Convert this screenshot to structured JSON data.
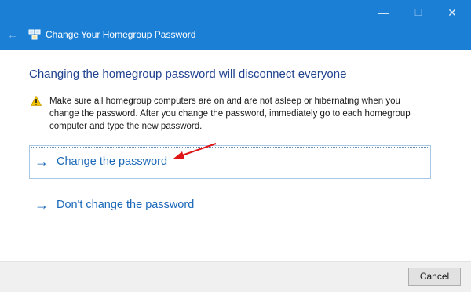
{
  "window": {
    "title": "Change Your Homegroup Password",
    "controls": {
      "minimize_icon": "—",
      "maximize_icon": "☐",
      "close_icon": "✕"
    },
    "back_icon": "←"
  },
  "content": {
    "heading": "Changing the homegroup password will disconnect everyone",
    "warning": "Make sure all homegroup computers are on and are not asleep or hibernating when you change the password. After you change the password, immediately go to each homegroup computer and type the new password.",
    "options": [
      {
        "label": "Change the password",
        "arrow": "→"
      },
      {
        "label": "Don't change the password",
        "arrow": "→"
      }
    ]
  },
  "footer": {
    "cancel_label": "Cancel"
  },
  "colors": {
    "titlebar": "#1b7fd6",
    "heading": "#20438f",
    "link": "#1a68b8",
    "annotation_arrow": "#e01515",
    "warning": "#f5c400"
  },
  "icons": [
    "back-arrow-icon",
    "homegroup-icon",
    "warning-icon",
    "arrow-right-icon",
    "annotation-arrow-icon"
  ]
}
